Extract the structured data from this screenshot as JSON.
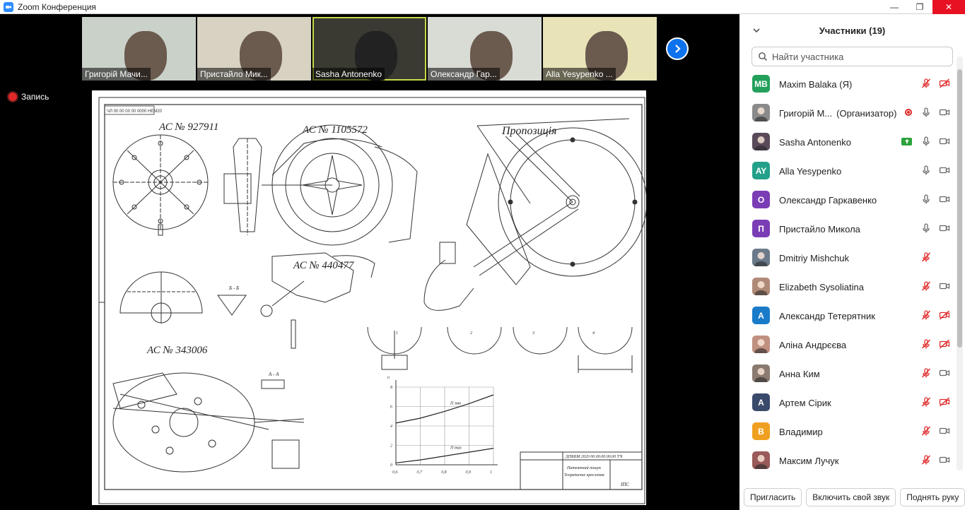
{
  "window": {
    "title": "Zoom Конференция"
  },
  "thumbnails": [
    {
      "name": "Григорій Мачи...",
      "bg": "#c9d1c9"
    },
    {
      "name": "Пристайло Мик...",
      "bg": "#d8d2c2"
    },
    {
      "name": "Sasha Antonenko",
      "bg": "#3a3a32",
      "active": true
    },
    {
      "name": "Олександр Гар...",
      "bg": "#d9dcd5"
    },
    {
      "name": "Alla Yesypenko ...",
      "bg": "#e8e4b8"
    }
  ],
  "recording": {
    "label": "Запись"
  },
  "drawing": {
    "labels": {
      "ac1": "АС № 927911",
      "ac2": "АС № 1105572",
      "ac3": "АС № 440477",
      "ac4": "АС № 343006",
      "proposal": "Пропозиція",
      "section": "Б - Б",
      "section2": "А - А",
      "stamp_code": "ДПББМ 2020 00.00.00.00.00 ТЧ",
      "stamp_t1": "Патентний пошук",
      "stamp_t2": "Теоретичне креслення",
      "stamp_org": "ІПС",
      "corner_code": "ЧЛ 00 00 00 00 0000 НЕМ20",
      "n_label": "n",
      "nmin_label": "П эмн",
      "nmax_label": "П max",
      "fig1": "1",
      "fig2": "2",
      "fig3": "3",
      "fig4": "4"
    }
  },
  "chart_data": {
    "type": "line",
    "title": "",
    "x": [
      0.6,
      0.7,
      0.8,
      0.9,
      1.0
    ],
    "xticks": [
      "0,6",
      "0,7",
      "0,8",
      "0,9",
      "1"
    ],
    "yticks": [
      "0",
      "2",
      "4",
      "6",
      "8"
    ],
    "xlabel": "",
    "ylabel": "",
    "ylim": [
      0,
      8
    ],
    "series": [
      {
        "name": "П эмн",
        "values": [
          4.3,
          4.8,
          5.5,
          6.3,
          7.2
        ]
      },
      {
        "name": "П max",
        "values": [
          0.2,
          0.5,
          0.9,
          1.3,
          1.7
        ]
      }
    ]
  },
  "panel": {
    "title": "Участники (19)",
    "search_placeholder": "Найти участника",
    "participants": [
      {
        "name": "Maxim Balaka (Я)",
        "initials": "MB",
        "color": "#23a05b",
        "mic": "muted",
        "cam": "off"
      },
      {
        "name": "Григорій М...",
        "role": "(Организатор)",
        "initials": "",
        "color": "#8a8a8a",
        "rec": true,
        "mic": "on",
        "cam": "on"
      },
      {
        "name": "Sasha Antonenko",
        "initials": "",
        "color": "#5a4a5a",
        "share": true,
        "mic": "on",
        "cam": "on"
      },
      {
        "name": "Alla Yesypenko",
        "initials": "AY",
        "color": "#23a08a",
        "mic": "on",
        "cam": "on"
      },
      {
        "name": "Олександр Гаркавенко",
        "initials": "О",
        "color": "#7b3db5",
        "mic": "on",
        "cam": "on"
      },
      {
        "name": "Пристайло Микола",
        "initials": "П",
        "color": "#7b3db5",
        "mic": "on",
        "cam": "on"
      },
      {
        "name": "Dmitriy Mishchuk",
        "initials": "",
        "color": "#6a7a8a",
        "mic": "muted",
        "cam": "none"
      },
      {
        "name": "Elizabeth Sysoliatina",
        "initials": "",
        "color": "#b08a78",
        "mic": "muted",
        "cam": "on"
      },
      {
        "name": "Александр Тетерятник",
        "initials": "А",
        "color": "#1a7bc9",
        "mic": "muted",
        "cam": "off"
      },
      {
        "name": "Аліна Андрєєва",
        "initials": "",
        "color": "#c09080",
        "mic": "muted",
        "cam": "off"
      },
      {
        "name": "Анна Ким",
        "initials": "",
        "color": "#8a7a70",
        "mic": "muted",
        "cam": "on"
      },
      {
        "name": "Артем Сірик",
        "initials": "А",
        "color": "#3a4a6a",
        "mic": "muted",
        "cam": "off"
      },
      {
        "name": "Владимир",
        "initials": "В",
        "color": "#f0a020",
        "mic": "muted",
        "cam": "on"
      },
      {
        "name": "Максим Лучук",
        "initials": "",
        "color": "#9a5a5a",
        "mic": "muted",
        "cam": "on"
      }
    ],
    "buttons": {
      "invite": "Пригласить",
      "unmute": "Включить свой звук",
      "raise": "Поднять руку"
    }
  }
}
